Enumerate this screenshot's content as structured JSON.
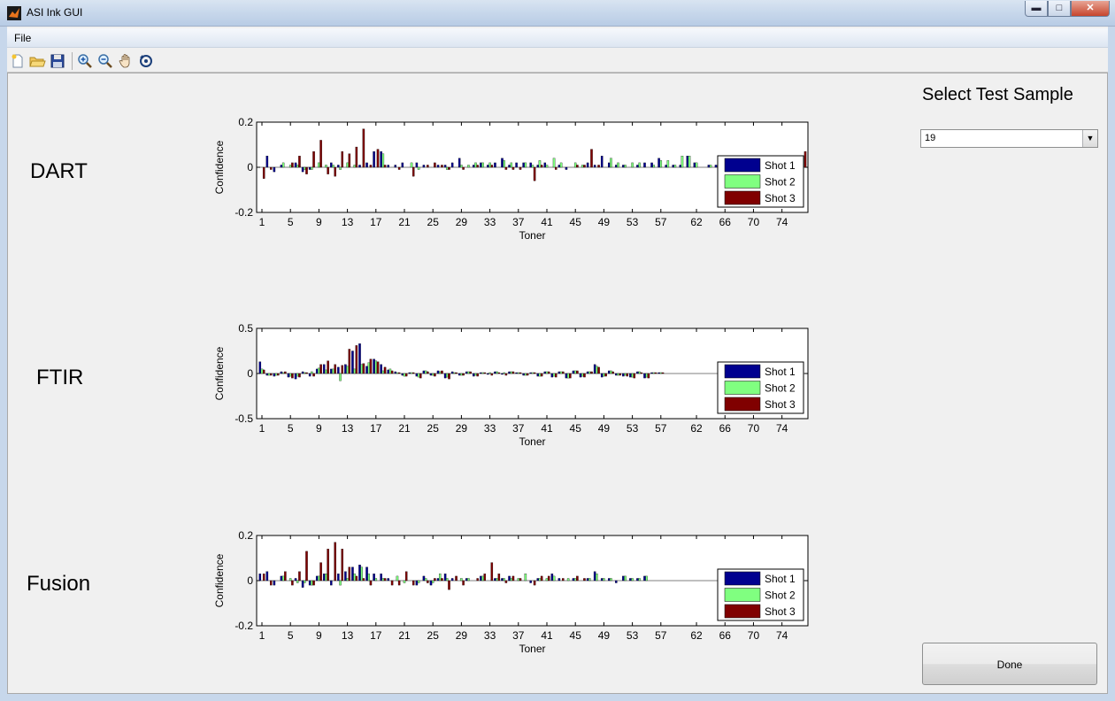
{
  "window": {
    "title": "ASI Ink GUI",
    "min": "▬",
    "max": "□",
    "close": "✕"
  },
  "menu": {
    "file": "File"
  },
  "toolbar": {
    "buttons": [
      "new-file-icon",
      "open-folder-icon",
      "save-icon",
      "zoom-in-icon",
      "zoom-out-icon",
      "pan-hand-icon",
      "rotate-3d-icon"
    ]
  },
  "rows": [
    {
      "label": "DART"
    },
    {
      "label": "FTIR"
    },
    {
      "label": "Fusion"
    }
  ],
  "select": {
    "title": "Select Test Sample",
    "value": "19",
    "arrow": "▼"
  },
  "done_label": "Done",
  "colors": {
    "shot1": "#00008f",
    "shot2": "#80ff80",
    "shot3": "#800000"
  },
  "chart_data": [
    {
      "type": "bar",
      "ylabel": "Confidence",
      "xlabel": "Toner",
      "ylim": [
        -0.2,
        0.2
      ],
      "yticks": [
        "0.2",
        "0",
        "-0.2"
      ],
      "xticks": [
        "1",
        "5",
        "9",
        "13",
        "17",
        "21",
        "25",
        "29",
        "33",
        "37",
        "41",
        "45",
        "49",
        "53",
        "57",
        "62",
        "66",
        "70",
        "74"
      ],
      "legend": "inside-right",
      "series": [
        {
          "name": "Shot 1",
          "values": [
            0.0,
            0.05,
            -0.02,
            0.01,
            0.0,
            0.02,
            -0.02,
            -0.01,
            0.0,
            0.0,
            0.02,
            0.01,
            0.0,
            0.0,
            0.01,
            0.02,
            0.07,
            0.07,
            0.01,
            0.01,
            0.02,
            0.0,
            0.02,
            0.01,
            0.0,
            0.01,
            0.01,
            0.02,
            0.04,
            0.0,
            0.01,
            0.02,
            0.01,
            0.02,
            0.04,
            0.01,
            0.02,
            0.02,
            0.02,
            0.01,
            0.02,
            0.0,
            0.01,
            -0.01,
            0.0,
            0.0,
            0.02,
            0.01,
            0.05,
            0.02,
            0.01,
            0.01,
            0.0,
            0.01,
            0.02,
            0.02,
            0.04,
            0.01,
            0.01,
            0.01,
            0.05,
            0.02,
            0.0,
            0.01,
            0.01,
            0.0,
            0.01,
            0.01,
            0.0,
            0.0,
            0.01,
            0.01,
            0.0,
            0.0,
            0.0,
            0.01,
            0.01
          ]
        },
        {
          "name": "Shot 2",
          "values": [
            0.0,
            0.0,
            0.0,
            0.02,
            0.01,
            0.01,
            -0.01,
            -0.01,
            0.02,
            0.01,
            0.01,
            -0.01,
            0.02,
            0.01,
            0.0,
            0.0,
            0.0,
            0.06,
            0.0,
            0.0,
            0.0,
            0.02,
            -0.01,
            0.0,
            0.0,
            0.0,
            -0.01,
            0.0,
            0.01,
            0.01,
            0.02,
            0.02,
            0.02,
            0.0,
            0.03,
            0.02,
            0.0,
            0.02,
            0.01,
            0.03,
            0.01,
            0.04,
            0.02,
            0.0,
            0.02,
            0.01,
            0.0,
            0.0,
            0.0,
            0.04,
            0.02,
            0.01,
            0.02,
            0.02,
            0.0,
            0.01,
            0.03,
            0.03,
            0.01,
            0.05,
            0.05,
            0.02,
            0.0,
            0.01,
            0.0,
            0.01,
            0.02,
            0.0,
            0.0,
            0.0,
            0.0,
            0.0,
            0.0,
            0.0,
            0.0,
            0.0,
            0.0
          ]
        },
        {
          "name": "Shot 3",
          "values": [
            -0.05,
            -0.01,
            0.0,
            0.0,
            0.02,
            0.05,
            -0.03,
            0.07,
            0.12,
            -0.03,
            -0.04,
            0.07,
            0.06,
            0.09,
            0.17,
            0.01,
            0.08,
            0.01,
            0.0,
            -0.01,
            0.0,
            -0.04,
            0.0,
            0.01,
            0.02,
            0.01,
            -0.01,
            0.0,
            -0.01,
            0.0,
            0.01,
            0.0,
            0.01,
            0.0,
            -0.01,
            -0.01,
            -0.01,
            0.0,
            -0.06,
            0.01,
            0.0,
            -0.01,
            0.0,
            0.0,
            0.01,
            0.01,
            0.08,
            0.01,
            0.0,
            0.0,
            0.0,
            0.0,
            0.0,
            0.0,
            0.0,
            0.0,
            0.0,
            0.0,
            0.0,
            0.0,
            0.0,
            0.0,
            0.0,
            0.0,
            0.0,
            0.0,
            0.0,
            0.0,
            0.0,
            0.0,
            0.0,
            0.0,
            0.0,
            0.0,
            0.0,
            0.0,
            0.07
          ]
        }
      ]
    },
    {
      "type": "bar",
      "ylabel": "Confidence",
      "xlabel": "Toner",
      "ylim": [
        -0.5,
        0.5
      ],
      "yticks": [
        "0.5",
        "0",
        "-0.5"
      ],
      "xticks": [
        "1",
        "5",
        "9",
        "13",
        "17",
        "21",
        "25",
        "29",
        "33",
        "37",
        "41",
        "45",
        "49",
        "53",
        "57",
        "62",
        "66",
        "70",
        "74"
      ],
      "legend": "inside-right",
      "series": [
        {
          "name": "Shot 1",
          "values": [
            0.13,
            -0.02,
            -0.03,
            0.02,
            -0.04,
            -0.06,
            0.02,
            -0.03,
            0.05,
            0.1,
            0.05,
            0.07,
            0.1,
            0.25,
            0.33,
            0.08,
            0.16,
            0.1,
            0.04,
            0.02,
            -0.02,
            0.01,
            -0.03,
            0.03,
            -0.02,
            0.03,
            -0.05,
            0.02,
            -0.02,
            0.02,
            -0.03,
            0.01,
            -0.01,
            0.02,
            -0.01,
            0.02,
            0.01,
            -0.02,
            0.01,
            -0.03,
            0.02,
            -0.04,
            0.02,
            -0.05,
            0.03,
            -0.04,
            0.02,
            0.1,
            -0.04,
            0.03,
            -0.02,
            -0.03,
            -0.04,
            0.02,
            -0.05,
            0.01,
            0.01,
            0.0,
            0.0,
            0.0,
            0.0,
            0.0,
            0.0,
            0.0,
            0.0,
            0.0,
            0.0,
            0.0,
            0.0,
            0.0,
            0.0,
            0.0,
            0.0,
            0.0,
            0.0,
            0.0,
            0.0
          ]
        },
        {
          "name": "Shot 2",
          "values": [
            0.05,
            -0.02,
            -0.02,
            0.01,
            -0.03,
            -0.03,
            0.01,
            0.02,
            0.06,
            0.04,
            0.05,
            -0.08,
            0.08,
            0.05,
            0.1,
            0.12,
            0.14,
            0.03,
            0.05,
            0.01,
            -0.03,
            0.01,
            -0.04,
            0.03,
            -0.02,
            0.02,
            -0.04,
            0.01,
            -0.02,
            0.02,
            -0.02,
            0.01,
            0.01,
            0.02,
            0.01,
            0.02,
            0.01,
            -0.02,
            0.01,
            -0.03,
            0.02,
            -0.03,
            0.02,
            -0.05,
            0.03,
            -0.03,
            0.02,
            0.08,
            -0.03,
            0.03,
            -0.02,
            -0.02,
            -0.04,
            0.02,
            -0.04,
            0.01,
            0.01,
            0.0,
            0.0,
            0.0,
            0.0,
            0.0,
            0.0,
            0.0,
            0.0,
            0.0,
            0.0,
            0.0,
            0.0,
            0.0,
            0.0,
            0.0,
            0.0,
            0.0,
            0.0,
            0.0,
            0.0
          ]
        },
        {
          "name": "Shot 3",
          "values": [
            0.04,
            -0.02,
            -0.02,
            0.02,
            -0.05,
            -0.04,
            0.01,
            -0.03,
            0.1,
            0.14,
            0.1,
            0.09,
            0.27,
            0.31,
            0.11,
            0.16,
            0.13,
            0.07,
            0.03,
            0.01,
            -0.03,
            0.01,
            -0.05,
            0.02,
            -0.03,
            0.03,
            -0.06,
            0.01,
            -0.02,
            0.02,
            -0.03,
            0.01,
            -0.02,
            0.01,
            -0.02,
            0.02,
            0.01,
            -0.02,
            0.01,
            -0.03,
            0.02,
            -0.04,
            0.02,
            -0.05,
            0.03,
            -0.04,
            0.02,
            0.07,
            -0.03,
            0.02,
            -0.02,
            -0.03,
            -0.05,
            0.01,
            -0.05,
            0.01,
            0.01,
            0.0,
            0.0,
            0.0,
            0.0,
            0.0,
            0.0,
            0.0,
            0.0,
            0.0,
            0.0,
            0.0,
            0.0,
            0.0,
            0.0,
            0.0,
            0.0,
            0.0,
            0.0,
            0.0,
            0.0
          ]
        }
      ]
    },
    {
      "type": "bar",
      "ylabel": "Confidence",
      "xlabel": "Toner",
      "ylim": [
        -0.2,
        0.2
      ],
      "yticks": [
        "0.2",
        "0",
        "-0.2"
      ],
      "xticks": [
        "1",
        "5",
        "9",
        "13",
        "17",
        "21",
        "25",
        "29",
        "33",
        "37",
        "41",
        "45",
        "49",
        "53",
        "57",
        "62",
        "66",
        "70",
        "74"
      ],
      "legend": "inside-right",
      "series": [
        {
          "name": "Shot 1",
          "values": [
            0.03,
            0.04,
            -0.02,
            0.02,
            0.0,
            0.01,
            -0.03,
            -0.02,
            0.02,
            0.03,
            -0.02,
            0.03,
            0.04,
            0.06,
            0.07,
            0.06,
            0.03,
            0.03,
            0.01,
            0.0,
            0.0,
            0.0,
            -0.02,
            0.02,
            -0.02,
            0.01,
            0.03,
            0.01,
            0.0,
            0.01,
            0.0,
            0.02,
            0.0,
            0.01,
            0.01,
            0.02,
            0.0,
            0.0,
            -0.01,
            0.01,
            0.0,
            0.03,
            0.01,
            0.0,
            0.01,
            0.0,
            0.01,
            0.04,
            0.01,
            0.01,
            -0.01,
            0.02,
            0.01,
            0.01,
            0.02,
            0.0,
            0.0,
            0.0,
            0.0,
            0.0,
            0.0,
            0.0,
            0.0,
            0.0,
            0.0,
            0.0,
            0.0,
            0.0,
            0.0,
            0.0,
            0.0,
            0.0,
            0.0,
            0.0,
            0.0,
            0.0,
            0.0
          ]
        },
        {
          "name": "Shot 2",
          "values": [
            0.0,
            0.0,
            0.0,
            0.02,
            0.01,
            -0.01,
            -0.01,
            -0.02,
            0.02,
            0.03,
            0.0,
            -0.02,
            0.01,
            0.03,
            0.06,
            0.03,
            0.01,
            0.01,
            0.0,
            0.02,
            -0.01,
            0.0,
            -0.01,
            0.01,
            -0.01,
            0.03,
            0.01,
            0.0,
            0.01,
            0.01,
            0.0,
            0.02,
            0.0,
            0.01,
            0.01,
            0.01,
            0.01,
            0.03,
            0.0,
            0.01,
            0.01,
            0.02,
            0.0,
            0.01,
            0.01,
            0.0,
            0.01,
            0.03,
            0.01,
            0.01,
            0.0,
            0.02,
            0.01,
            0.01,
            0.02,
            0.0,
            0.0,
            0.0,
            0.0,
            0.0,
            0.0,
            0.0,
            0.0,
            0.0,
            0.0,
            0.0,
            0.0,
            0.0,
            0.0,
            0.0,
            0.0,
            0.0,
            0.0,
            0.0,
            0.0,
            0.0,
            0.0
          ]
        },
        {
          "name": "Shot 3",
          "values": [
            0.03,
            -0.02,
            0.0,
            0.04,
            -0.02,
            0.04,
            0.13,
            -0.02,
            0.08,
            0.14,
            0.17,
            0.14,
            0.06,
            0.02,
            0.01,
            -0.02,
            0.0,
            0.01,
            -0.02,
            -0.02,
            0.04,
            -0.02,
            0.0,
            -0.01,
            0.01,
            0.01,
            -0.04,
            0.02,
            -0.02,
            0.0,
            0.01,
            0.03,
            0.08,
            0.03,
            -0.01,
            0.02,
            0.01,
            0.0,
            -0.02,
            0.02,
            0.02,
            0.0,
            0.01,
            0.0,
            0.02,
            0.01,
            0.0,
            0.0,
            0.0,
            0.0,
            0.0,
            0.0,
            0.0,
            0.0,
            0.0,
            0.0,
            0.0,
            0.0,
            0.0,
            0.0,
            0.0,
            0.0,
            0.0,
            0.0,
            0.0,
            0.0,
            0.0,
            0.0,
            0.0,
            0.0,
            0.0,
            0.0,
            0.0,
            0.0,
            0.0,
            0.0,
            0.0
          ]
        }
      ]
    }
  ]
}
